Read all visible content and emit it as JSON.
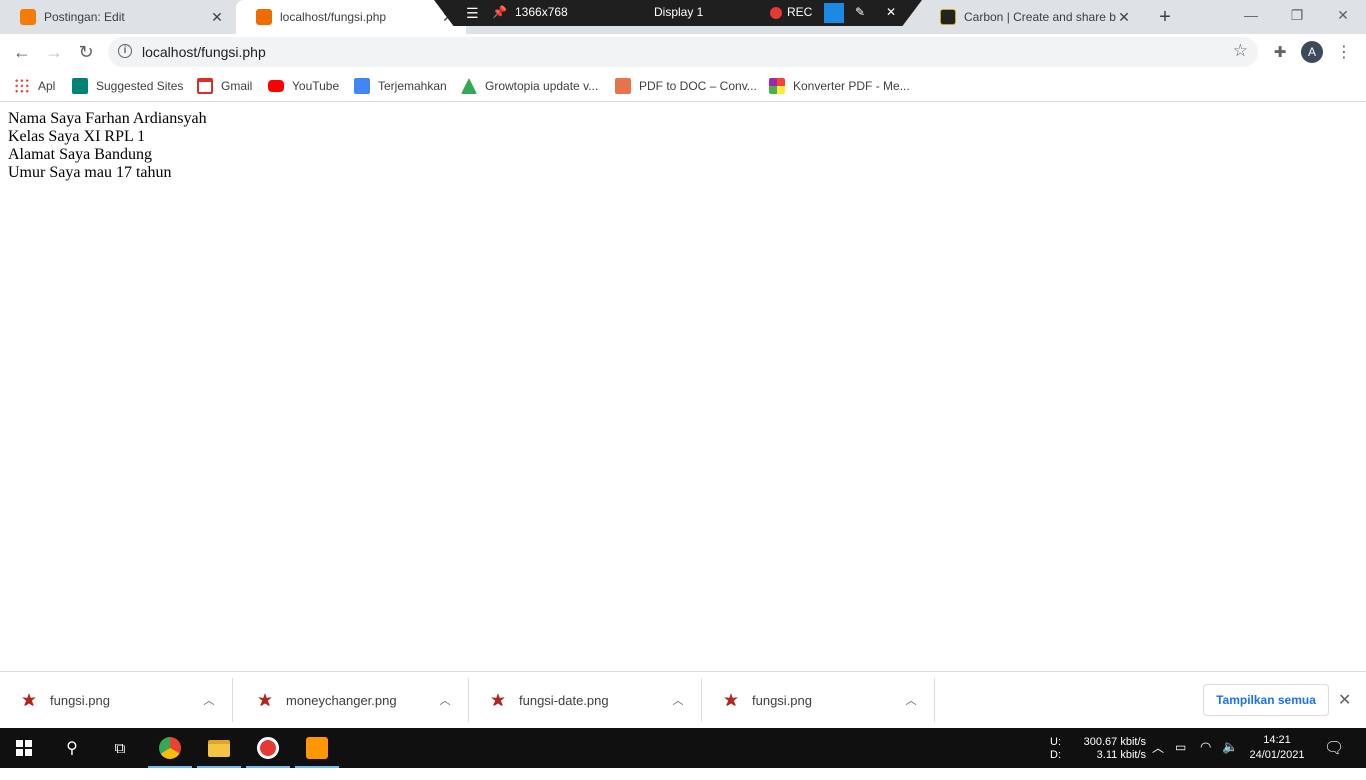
{
  "tabs": [
    {
      "title": "Postingan: Edit",
      "favicon_color": "#f57c00",
      "active": false
    },
    {
      "title": "localhost/fungsi.php",
      "favicon_color": "#ef6c00",
      "active": true
    },
    {
      "title": "Carbon | Create and share bea",
      "favicon_color": "#222222",
      "active": false
    }
  ],
  "recorder": {
    "resolution": "1366x768",
    "display": "Display 1",
    "rec": "REC"
  },
  "toolbar": {
    "url": "localhost/fungsi.php",
    "avatar": "A"
  },
  "bookmarks": [
    {
      "label": "Apl",
      "icon": "apps-grid-icon",
      "color": "#ea4335"
    },
    {
      "label": "Suggested Sites",
      "icon": "bing-icon",
      "color": "#008373"
    },
    {
      "label": "Gmail",
      "icon": "gmail-icon",
      "color": "#d93025"
    },
    {
      "label": "YouTube",
      "icon": "youtube-icon",
      "color": "#ff0000"
    },
    {
      "label": "Terjemahkan",
      "icon": "translate-icon",
      "color": "#4285f4"
    },
    {
      "label": "Growtopia update v...",
      "icon": "growtopia-icon",
      "color": "#34a853"
    },
    {
      "label": "PDF to DOC – Conv...",
      "icon": "pdf-icon",
      "color": "#e8734a"
    },
    {
      "label": "Konverter PDF - Me...",
      "icon": "converter-icon",
      "color": "#9c27b0"
    }
  ],
  "content": {
    "lines": [
      "Nama Saya Farhan Ardiansyah",
      "Kelas Saya XI RPL 1",
      "Alamat Saya Bandung",
      "Umur Saya mau 17 tahun"
    ]
  },
  "downloads": [
    {
      "name": "fungsi.png"
    },
    {
      "name": "moneychanger.png"
    },
    {
      "name": "fungsi-date.png"
    },
    {
      "name": "fungsi.png"
    }
  ],
  "shelf": {
    "show_all": "Tampilkan semua"
  },
  "taskbar": {
    "net_up_label": "U:",
    "net_down_label": "D:",
    "net_up": "300.67 kbit/s",
    "net_down": "3.11 kbit/s",
    "time": "14:21",
    "date": "24/01/2021"
  }
}
